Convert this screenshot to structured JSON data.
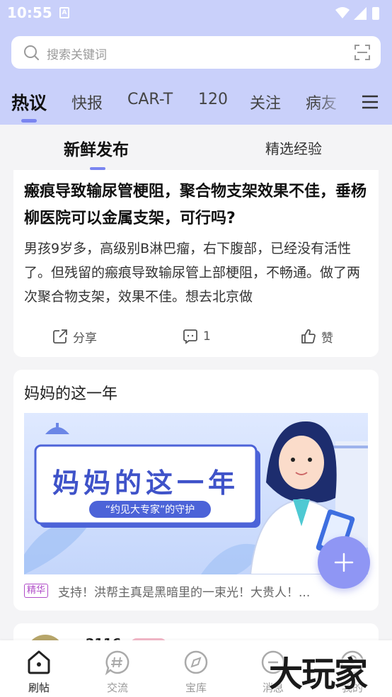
{
  "status_bar": {
    "time": "10:55",
    "notification_icon": "A"
  },
  "search": {
    "placeholder": "搜索关键词"
  },
  "tabs": [
    {
      "label": "热议",
      "active": true
    },
    {
      "label": "快报"
    },
    {
      "label": "CAR-T"
    },
    {
      "label": "120"
    },
    {
      "label": "关注"
    },
    {
      "label": "病友"
    }
  ],
  "subtabs": [
    {
      "label": "新鲜发布",
      "active": true
    },
    {
      "label": "精选经验"
    }
  ],
  "post1": {
    "title": "瘢痕导致输尿管梗阻，聚合物支架效果不佳，垂杨柳医院可以金属支架，可行吗?",
    "body": "男孩9岁多，高级别B淋巴瘤，右下腹部，已经没有活性了。但残留的瘢痕导致输尿管上部梗阻，不畅通。做了两次聚合物支架，效果不佳。想去北京做",
    "share_label": "分享",
    "comment_count": "1",
    "like_label": "赞"
  },
  "post2": {
    "title": "妈妈的这一年",
    "banner_title": "妈妈的这一年",
    "banner_subtitle": "“约见大专家”的守护",
    "badge": "精华",
    "excerpt": "支持！洪帮主真是黑暗里的一束光！大贵人！..."
  },
  "post3": {
    "username_partial": "2116"
  },
  "bottom_nav": [
    {
      "label": "刷帖",
      "icon": "home-icon",
      "active": true
    },
    {
      "label": "交流",
      "icon": "hashtag-bubble-icon"
    },
    {
      "label": "宝库",
      "icon": "compass-icon"
    },
    {
      "label": "消息",
      "icon": "message-icon"
    },
    {
      "label": "我的",
      "icon": "profile-icon"
    }
  ],
  "watermark": "大玩家",
  "colors": {
    "header_bg": "#c9d0fa",
    "accent": "#7a85f0",
    "fab": "#8f96f4",
    "badge": "#b04cc8"
  }
}
